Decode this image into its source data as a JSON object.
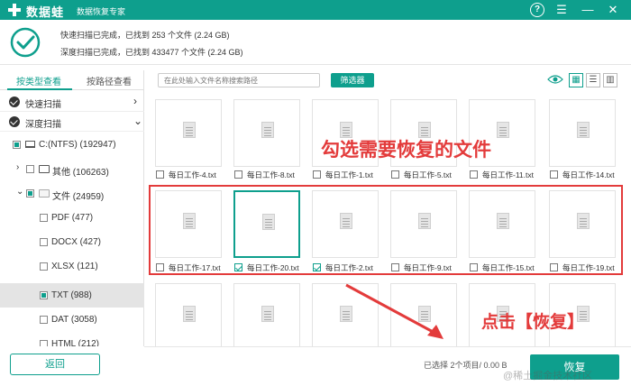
{
  "titlebar": {
    "app_name": "数据蛙",
    "app_subtitle": "数据恢复专家",
    "help": "?",
    "menu": "☰",
    "minimize": "—",
    "close": "✕"
  },
  "summary": {
    "quick_scan": "快速扫描已完成，已找到 253 个文件 (2.24 GB)",
    "deep_scan": "深度扫描已完成，已找到 433477 个文件 (2.24 GB)"
  },
  "left_panel": {
    "tabs": [
      "按类型查看",
      "按路径查看"
    ],
    "scan_rows": [
      {
        "label": "快速扫描"
      },
      {
        "label": "深度扫描"
      }
    ],
    "tree": [
      {
        "label": "C:(NTFS) (192947)"
      },
      {
        "label": "其他 (106263)"
      },
      {
        "label": "文件 (24959)"
      },
      {
        "label": "PDF (477)"
      },
      {
        "label": "DOCX (427)"
      },
      {
        "label": "XLSX (121)"
      },
      {
        "label": "TXT (988)"
      },
      {
        "label": "DAT (3058)"
      },
      {
        "label": "HTML (212)"
      }
    ],
    "back_label": "返回"
  },
  "toolbar": {
    "search_placeholder": "在此处输入文件名称搜索路径",
    "filter_label": "筛选器",
    "view_grid": "▦",
    "view_list": "☰",
    "view_detail": "▥"
  },
  "files": {
    "row1": [
      "每日工作-4.txt",
      "每日工作-8.txt",
      "每日工作-1.txt",
      "每日工作-5.txt",
      "每日工作-11.txt",
      "每日工作-14.txt"
    ],
    "row2": [
      "每日工作-17.txt",
      "每日工作-20.txt",
      "每日工作-2.txt",
      "每日工作-9.txt",
      "每日工作-15.txt",
      "每日工作-19.txt"
    ],
    "row2_checked": [
      false,
      true,
      true,
      false,
      false,
      false
    ]
  },
  "annotations": {
    "tip1": "勾选需要恢复的文件",
    "tip2": "点击【恢复】"
  },
  "footer": {
    "selected_info": "已选择 2个项目/ 0.00  B",
    "restore_label": "恢复",
    "watermark": "@稀土掘金技术社区"
  },
  "colors": {
    "accent": "#0e9f8d",
    "annotation": "#e33b3b"
  }
}
